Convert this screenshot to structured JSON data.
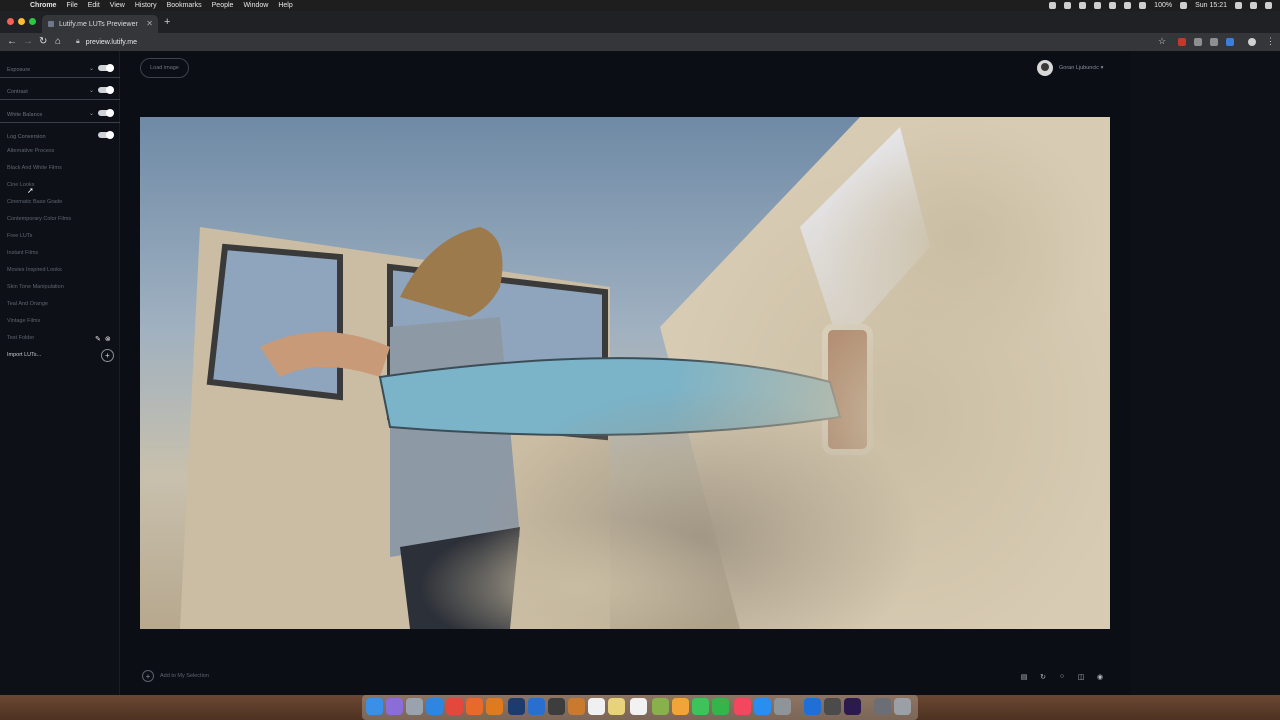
{
  "menubar": {
    "app": "Chrome",
    "items": [
      "File",
      "Edit",
      "View",
      "History",
      "Bookmarks",
      "People",
      "Window",
      "Help"
    ],
    "battery": "100%",
    "clock": "Sun 15:21"
  },
  "browser": {
    "tab_title": "Lutify.me LUTs Previewer",
    "url": "preview.lutify.me"
  },
  "sidebar": {
    "adjustments": [
      {
        "label": "Exposure"
      },
      {
        "label": "Contrast"
      },
      {
        "label": "White Balance"
      },
      {
        "label": "Log Conversion"
      }
    ],
    "lut_categories": [
      "Alternative Process",
      "Black And White Films",
      "Cine Looks",
      "Cinematic Base Grade",
      "Contemporary Color Films",
      "Free LUTs",
      "Instant Films",
      "Movies Inspired Looks",
      "Skin Tone Manipulation",
      "Teal And Orange",
      "Vintage Films",
      "Test Folder"
    ],
    "import_label": "Import LUTs..."
  },
  "main": {
    "load_image_label": "Load image",
    "user_name": "Goran Ljubuncic ▾",
    "add_selection_label": "Add to My Selection"
  },
  "icons": {
    "toggle": "toggle-icon",
    "chevron": "chevron-down-icon",
    "edit": "pencil-icon",
    "delete": "delete-icon",
    "plus": "plus-icon"
  }
}
